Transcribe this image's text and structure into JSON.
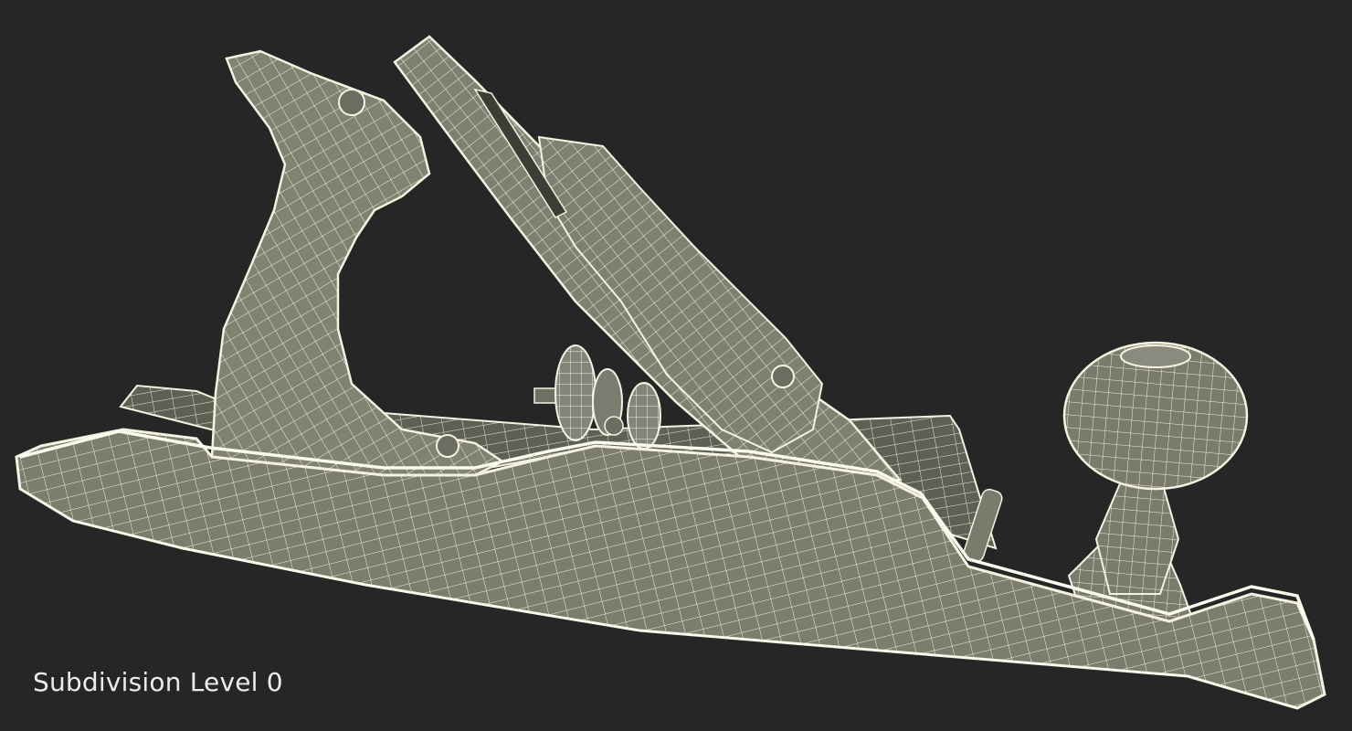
{
  "viewport": {
    "caption": "Subdivision Level 0",
    "background_color": "#262626",
    "wire_color": "#f4f2e0",
    "surface_color": "#7c7d6e",
    "shadow_color": "#55564b"
  }
}
